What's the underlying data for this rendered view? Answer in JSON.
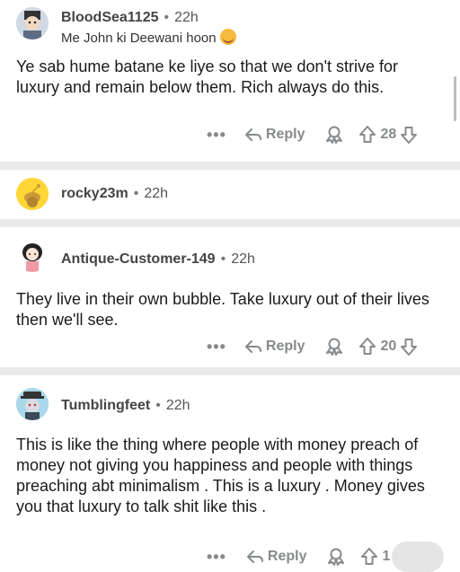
{
  "comments": [
    {
      "username": "BloodSea1125",
      "time": "22h",
      "flair": "Me John ki Deewani hoon",
      "text": "Ye sab hume batane ke liye so that we don't strive for luxury and remain below them. Rich always do this.",
      "reply_label": "Reply",
      "score": "28"
    },
    {
      "username": "rocky23m",
      "time": "22h"
    },
    {
      "username": "Antique-Customer-149",
      "time": "22h",
      "text": "They live in their own bubble. Take luxury out of their lives then we'll see.",
      "reply_label": "Reply",
      "score": "20"
    },
    {
      "username": "Tumblingfeet",
      "time": "22h",
      "text": "This is like the thing where people with money preach of money not giving you happiness and people with things preaching abt minimalism . This is a luxury . Money gives you that luxury to talk shit like this .",
      "reply_label": "Reply",
      "score": "1"
    }
  ],
  "dot_separator": "•",
  "more_glyph": "•••",
  "icons": [
    "more-icon",
    "reply-arrow-icon",
    "award-icon",
    "upvote-icon",
    "downvote-icon"
  ],
  "colors": {
    "separator": "#eaeaea",
    "muted": "#878a8c",
    "snoo_bg": "#ffd635"
  }
}
